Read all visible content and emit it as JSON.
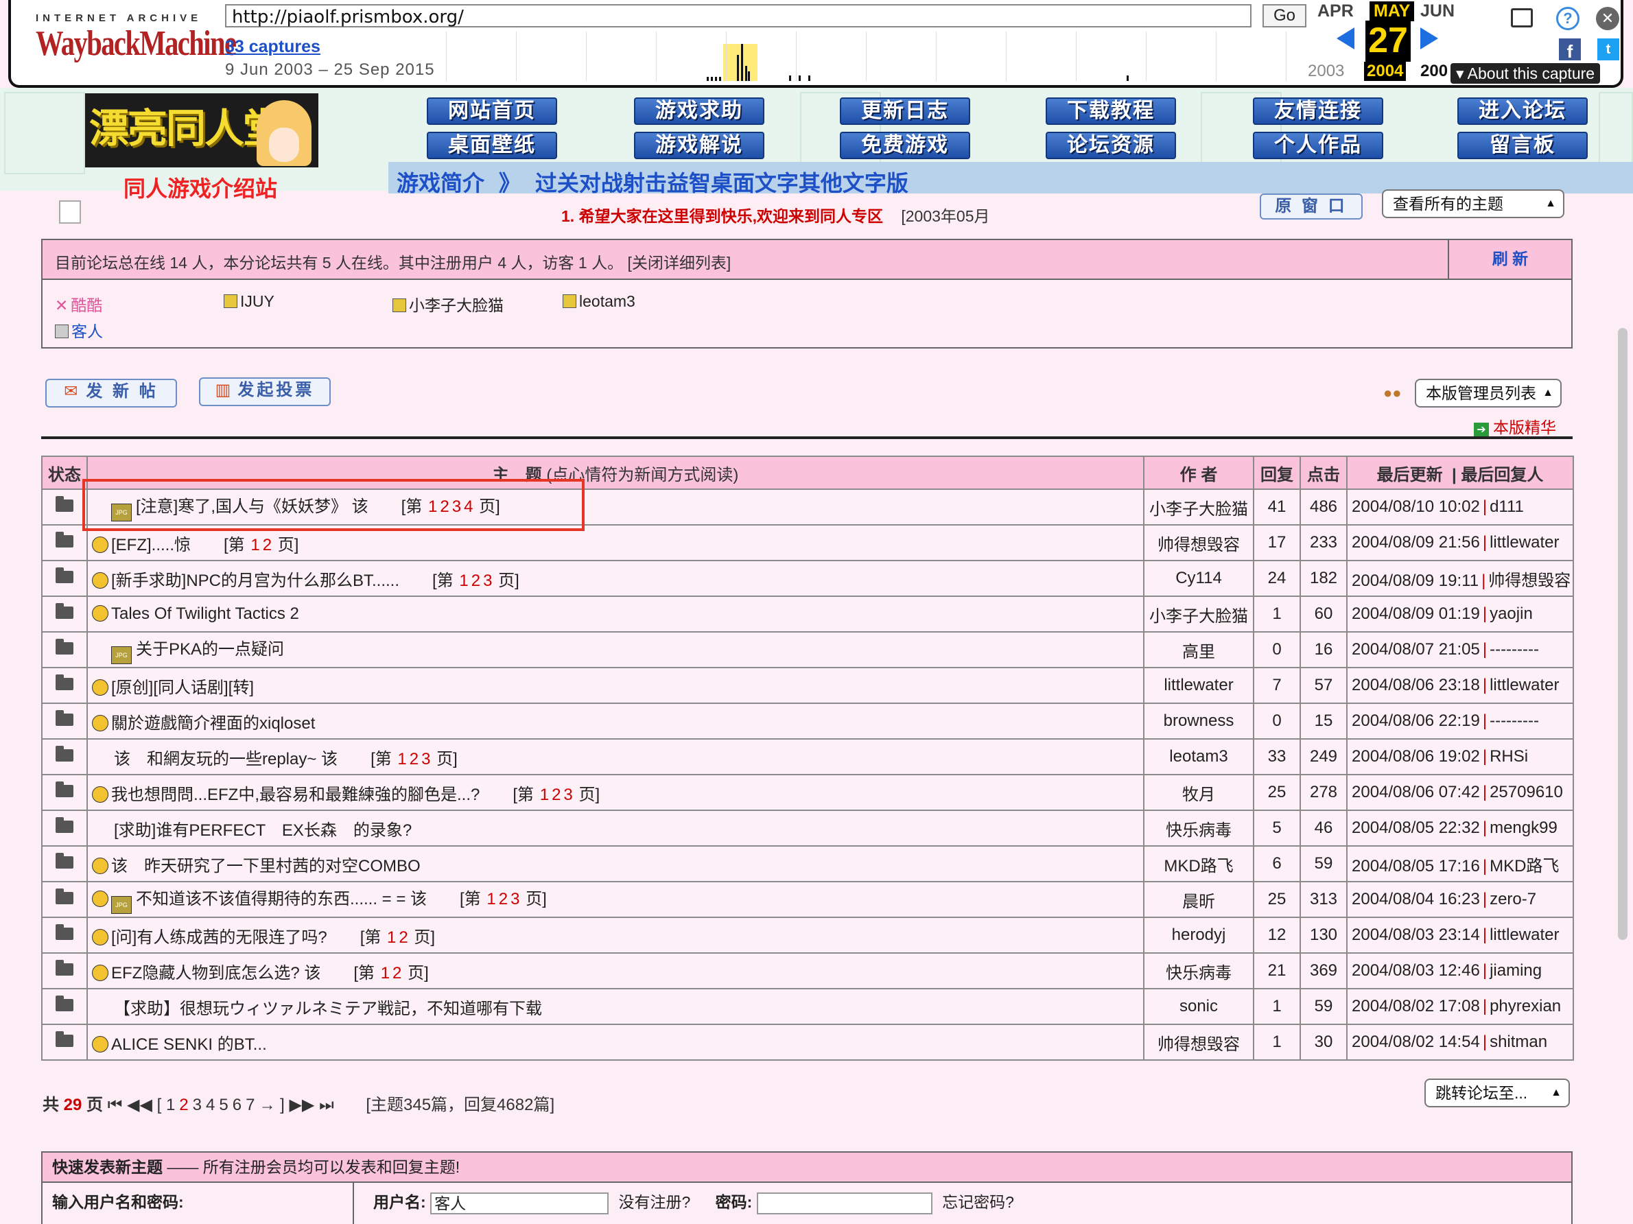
{
  "wayback": {
    "logo_top": "INTERNET ARCHIVE",
    "logo": "WaybackMachine",
    "url": "http://piaolf.prismbox.org/",
    "go": "Go",
    "captures": "33 captures",
    "range": "9 Jun 2003 – 25 Sep 2015",
    "months": {
      "prev": "APR",
      "cur": "MAY",
      "next": "JUN"
    },
    "day": "27",
    "years": {
      "prev": "2003",
      "cur": "2004",
      "next": "200"
    },
    "about": "▾ About this capture"
  },
  "site": {
    "logo_text": "漂亮同人堂",
    "logo_sub": "同人游戏介绍站",
    "nav": [
      "网站首页",
      "游戏求助",
      "更新日志",
      "下载教程",
      "友情连接",
      "进入论坛",
      "桌面壁纸",
      "游戏解说",
      "免费游戏",
      "论坛资源",
      "个人作品",
      "留言板"
    ],
    "breadcrumb": {
      "parts": [
        "游戏简介",
        "》",
        "过关对战射击益智桌面文字其他文字版"
      ]
    }
  },
  "notice": {
    "text": "1. 希望大家在这里得到快乐,欢迎来到同人专区",
    "date": "[2003年05月"
  },
  "buttons": {
    "orig_window": "原 窗 口",
    "view_topics": "查看所有的主题",
    "new_post": "发 新 帖",
    "new_poll": "发起投票",
    "moderators": "本版管理员列表",
    "digest": "本版精华",
    "jump": "跳转论坛至..."
  },
  "online": {
    "text": "目前论坛总在线 14 人，本分论坛共有 5 人在线。其中注册用户 4 人，访客 1 人。   [关闭详细列表]",
    "refresh": "刷 新",
    "users": [
      "酷酷",
      "IJUY",
      "小李子大脸猫",
      "leotam3",
      "客人"
    ]
  },
  "table": {
    "headers": {
      "status": "状态",
      "topic": "主　题",
      "topic_hint": "(点心情符为新闻方式阅读)",
      "author": "作 者",
      "replies": "回复",
      "views": "点击",
      "updated": "最后更新",
      "last_by": "| 最后回复人"
    },
    "rows": [
      {
        "title": "[注意]寒了,国人与《妖妖梦》 该",
        "pages": [
          "1",
          "2",
          "3",
          "4"
        ],
        "author": "小李子大脸猫",
        "replies": "41",
        "views": "486",
        "date": "2004/08/10 10:02",
        "last": "d111",
        "icon": "tag"
      },
      {
        "title": "[EFZ].....惊",
        "pages": [
          "1",
          "2"
        ],
        "author": "帅得想毁容",
        "replies": "17",
        "views": "233",
        "date": "2004/08/09 21:56",
        "last": "littlewater",
        "icon": "mood"
      },
      {
        "title": "[新手求助]NPC的月宫为什么那么BT......",
        "pages": [
          "1",
          "2",
          "3"
        ],
        "author": "Cy114",
        "replies": "24",
        "views": "182",
        "date": "2004/08/09 19:11",
        "last": "帅得想毁容",
        "icon": "mood"
      },
      {
        "title": "Tales Of Twilight Tactics 2",
        "pages": [],
        "author": "小李子大脸猫",
        "replies": "1",
        "views": "60",
        "date": "2004/08/09 01:19",
        "last": "yaojin",
        "icon": "mood"
      },
      {
        "title": "关于PKA的一点疑问",
        "pages": [],
        "author": "高里",
        "replies": "0",
        "views": "16",
        "date": "2004/08/07 21:05",
        "last": "---------",
        "icon": "tag"
      },
      {
        "title": "[原创][同人话剧][转]",
        "pages": [],
        "author": "littlewater",
        "replies": "7",
        "views": "57",
        "date": "2004/08/06 23:18",
        "last": "littlewater",
        "icon": "mood"
      },
      {
        "title": "關於遊戲簡介裡面的xiqloset",
        "pages": [],
        "author": "browness",
        "replies": "0",
        "views": "15",
        "date": "2004/08/06 22:19",
        "last": "---------",
        "icon": "mood"
      },
      {
        "title": "该　和網友玩的一些replay~ 该",
        "pages": [
          "1",
          "2",
          "3"
        ],
        "author": "leotam3",
        "replies": "33",
        "views": "249",
        "date": "2004/08/06 19:02",
        "last": "RHSi",
        "icon": "none"
      },
      {
        "title": "我也想問問...EFZ中,最容易和最難練強的腳色是...?",
        "pages": [
          "1",
          "2",
          "3"
        ],
        "author": "牧月",
        "replies": "25",
        "views": "278",
        "date": "2004/08/06 07:42",
        "last": "25709610",
        "icon": "mood"
      },
      {
        "title": "[求助]谁有PERFECT　EX长森　的录象?",
        "pages": [],
        "author": "快乐病毒",
        "replies": "5",
        "views": "46",
        "date": "2004/08/05 22:32",
        "last": "mengk99",
        "icon": "none"
      },
      {
        "title": "该　昨天研究了一下里村茜的对空COMBO",
        "pages": [],
        "author": "MKD路飞",
        "replies": "6",
        "views": "59",
        "date": "2004/08/05 17:16",
        "last": "MKD路飞",
        "icon": "mood"
      },
      {
        "title": "不知道该不该值得期待的东西...... = = 该",
        "pages": [
          "1",
          "2",
          "3"
        ],
        "author": "晨昕",
        "replies": "25",
        "views": "313",
        "date": "2004/08/04 16:23",
        "last": "zero-7",
        "icon": "moodtag"
      },
      {
        "title": "[问]有人练成茜的无限连了吗?",
        "pages": [
          "1",
          "2"
        ],
        "author": "herodyj",
        "replies": "12",
        "views": "130",
        "date": "2004/08/03 23:14",
        "last": "littlewater",
        "icon": "mood"
      },
      {
        "title": "EFZ隐藏人物到底怎么选? 该",
        "pages": [
          "1",
          "2"
        ],
        "author": "快乐病毒",
        "replies": "21",
        "views": "369",
        "date": "2004/08/03 12:46",
        "last": "jiaming",
        "icon": "mood"
      },
      {
        "title": "【求助】很想玩ウィツァルネミテア戦記，不知道哪有下载",
        "pages": [],
        "author": "sonic",
        "replies": "1",
        "views": "59",
        "date": "2004/08/02 17:08",
        "last": "phyrexian",
        "icon": "none"
      },
      {
        "title": "ALICE SENKI 的BT...",
        "pages": [],
        "author": "帅得想毁容",
        "replies": "1",
        "views": "30",
        "date": "2004/08/02 14:54",
        "last": "shitman",
        "icon": "mood"
      }
    ],
    "page_label_prefix": "[第",
    "page_label_suffix": "页]"
  },
  "pager": {
    "prefix": "共",
    "total": "29",
    "suffix": "页",
    "first": "⏮",
    "prev": "◀◀",
    "pages": [
      "1",
      "2",
      "3",
      "4",
      "5",
      "6",
      "7"
    ],
    "current": "2",
    "next_arrow": "→",
    "next": "▶▶",
    "last": "⏭",
    "stats": "[主题345篇，回复4682篇]"
  },
  "quick": {
    "title_bold": "快速发表新主题",
    "title_rest": " —— 所有注册会员均可以发表和回复主题!",
    "login_label": "输入用户名和密码:",
    "username_label": "用户名:",
    "username_value": "客人",
    "not_registered": "没有注册?",
    "password_label": "密码:",
    "forgot": "忘记密码?"
  },
  "colors": {
    "accent_pink": "#fbc2dc",
    "link_blue": "#1d4fc7",
    "red": "#c00",
    "highlight": "#e53524"
  }
}
